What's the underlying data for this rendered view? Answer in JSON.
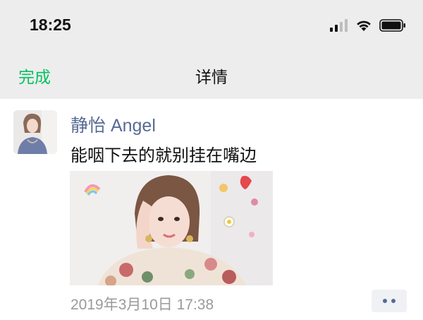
{
  "status_bar": {
    "time": "18:25",
    "icons": [
      "signal-icon",
      "wifi-icon",
      "battery-icon"
    ]
  },
  "nav": {
    "done_label": "完成",
    "title": "详情"
  },
  "post": {
    "author": "静怡 Angel",
    "text": "能咽下去的就别挂在嘴边",
    "timestamp": "2019年3月10日 17:38",
    "more_icon": "more-dots-icon"
  },
  "colors": {
    "accent_green": "#07c160",
    "link_blue": "#576b95",
    "bar_gray": "#ededed",
    "meta_gray": "#9a9a9a"
  }
}
